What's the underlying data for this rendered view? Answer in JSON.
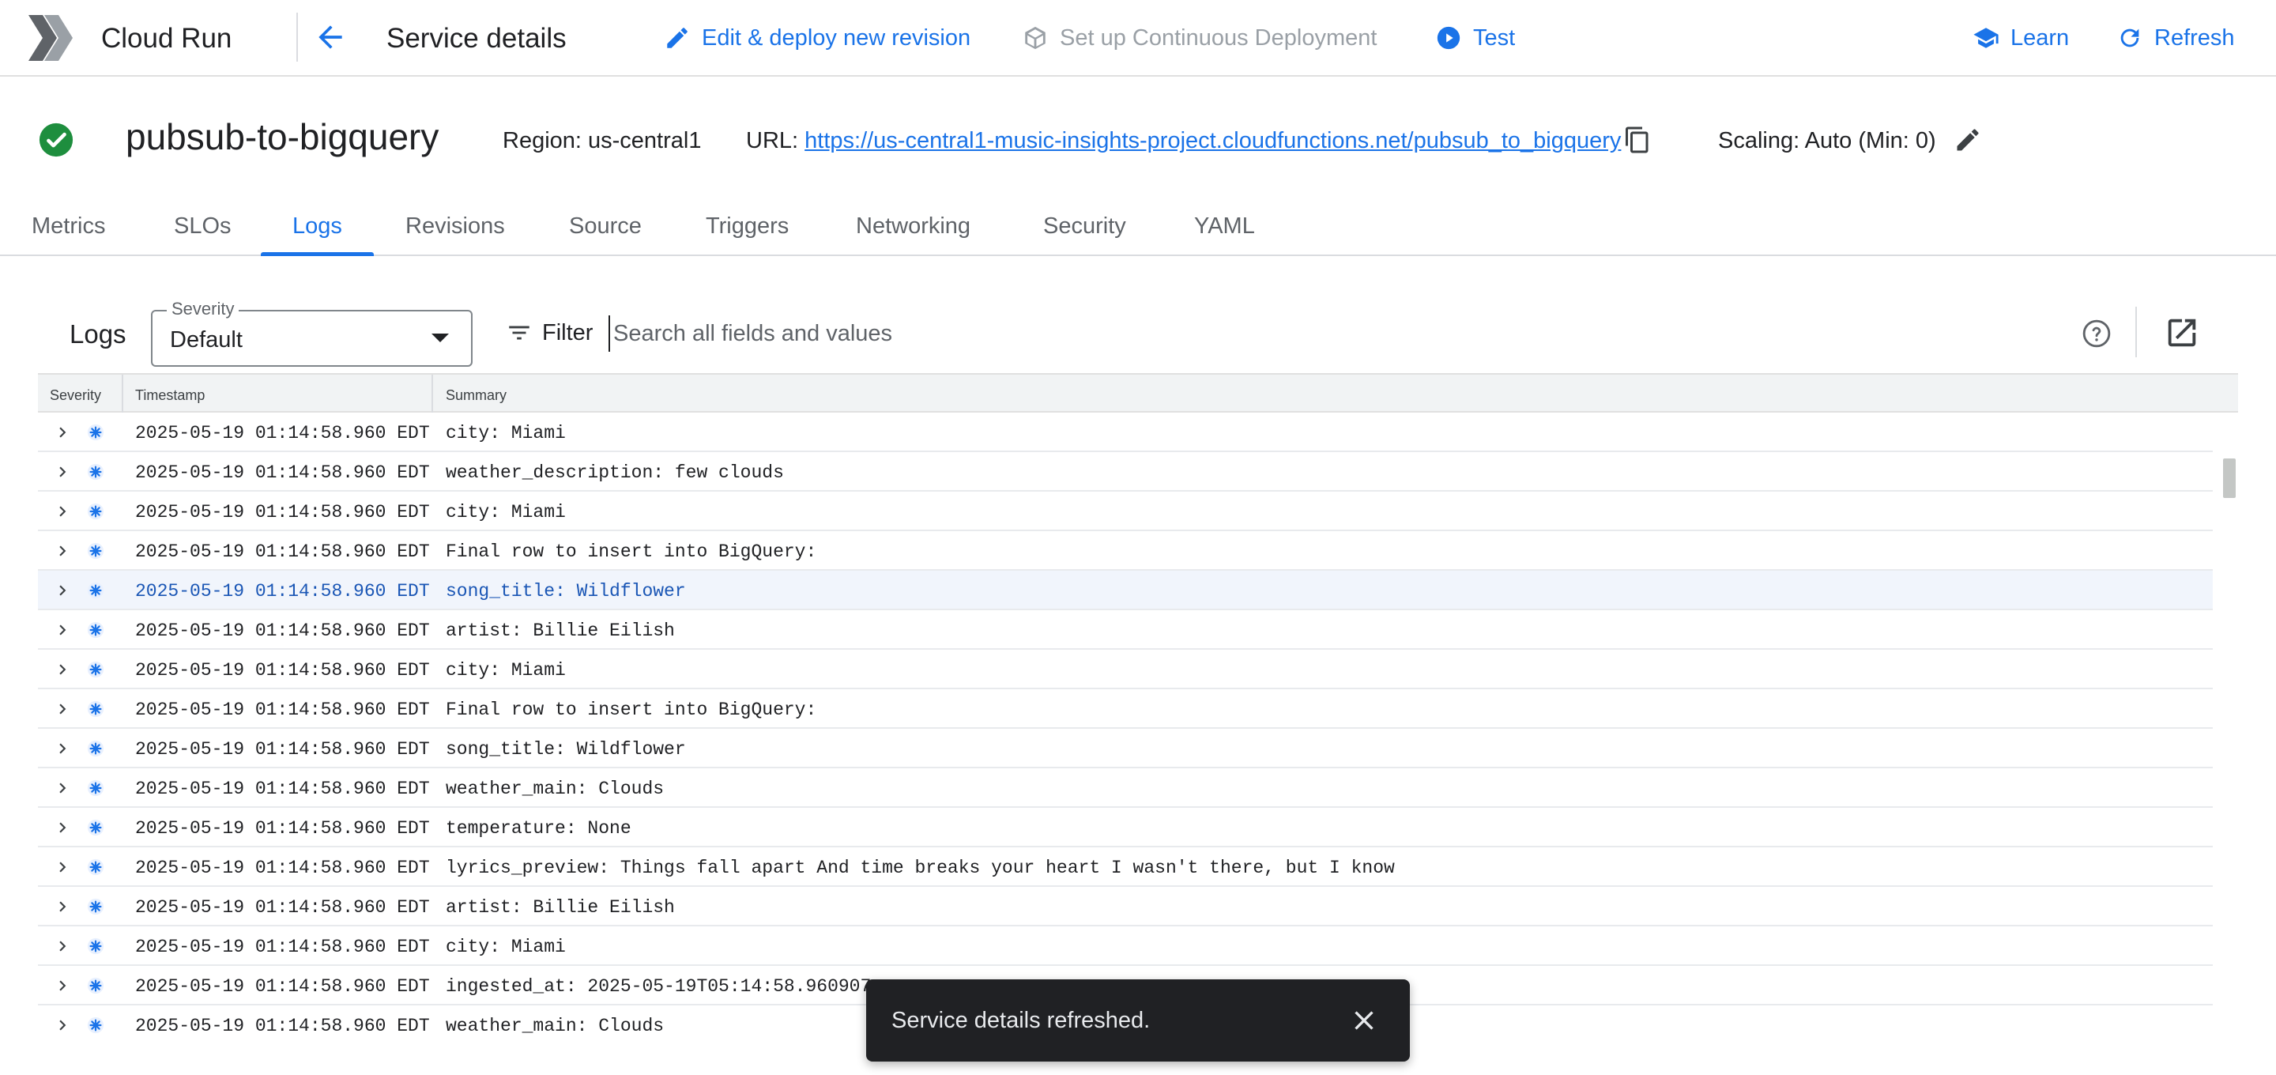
{
  "appbar": {
    "product": "Cloud Run",
    "page_title": "Service details",
    "actions": {
      "edit_deploy": "Edit & deploy new revision",
      "continuous_deployment": "Set up Continuous Deployment",
      "test": "Test",
      "learn": "Learn",
      "refresh": "Refresh"
    }
  },
  "service": {
    "name": "pubsub-to-bigquery",
    "region": "Region: us-central1",
    "url_label": "URL:",
    "url": "https://us-central1-music-insights-project.cloudfunctions.net/pubsub_to_bigquery",
    "scaling_label": "Scaling:",
    "scaling_value": "Auto",
    "scaling_min": "(Min: 0)"
  },
  "tabs": {
    "metrics": "Metrics",
    "slos": "SLOs",
    "logs": "Logs",
    "revisions": "Revisions",
    "source": "Source",
    "triggers": "Triggers",
    "networking": "Networking",
    "security": "Security",
    "yaml": "YAML"
  },
  "logs": {
    "title": "Logs",
    "severity_legend": "Severity",
    "severity_value": "Default",
    "filter_label": "Filter",
    "search_placeholder": "Search all fields and values",
    "columns": {
      "severity": "Severity",
      "timestamp": "Timestamp",
      "summary": "Summary"
    },
    "rows": [
      {
        "ts": "2025-05-19 01:14:58.960 EDT",
        "summary": "city: Miami"
      },
      {
        "ts": "2025-05-19 01:14:58.960 EDT",
        "summary": "weather_description: few clouds"
      },
      {
        "ts": "2025-05-19 01:14:58.960 EDT",
        "summary": "city: Miami"
      },
      {
        "ts": "2025-05-19 01:14:58.960 EDT",
        "summary": "Final row to insert into BigQuery:"
      },
      {
        "ts": "2025-05-19 01:14:58.960 EDT",
        "summary": "song_title: Wildflower"
      },
      {
        "ts": "2025-05-19 01:14:58.960 EDT",
        "summary": "artist: Billie Eilish"
      },
      {
        "ts": "2025-05-19 01:14:58.960 EDT",
        "summary": "city: Miami"
      },
      {
        "ts": "2025-05-19 01:14:58.960 EDT",
        "summary": "Final row to insert into BigQuery:"
      },
      {
        "ts": "2025-05-19 01:14:58.960 EDT",
        "summary": "song_title: Wildflower"
      },
      {
        "ts": "2025-05-19 01:14:58.960 EDT",
        "summary": "weather_main: Clouds"
      },
      {
        "ts": "2025-05-19 01:14:58.960 EDT",
        "summary": "temperature: None"
      },
      {
        "ts": "2025-05-19 01:14:58.960 EDT",
        "summary": "lyrics_preview: Things fall apart And time breaks your heart I wasn't there, but I know"
      },
      {
        "ts": "2025-05-19 01:14:58.960 EDT",
        "summary": "artist: Billie Eilish"
      },
      {
        "ts": "2025-05-19 01:14:58.960 EDT",
        "summary": "city: Miami"
      },
      {
        "ts": "2025-05-19 01:14:58.960 EDT",
        "summary": "ingested_at: 2025-05-19T05:14:58.960907"
      },
      {
        "ts": "2025-05-19 01:14:58.960 EDT",
        "summary": "weather_main: Clouds"
      }
    ]
  },
  "snackbar": {
    "message": "Service details refreshed."
  },
  "colors": {
    "accent": "#1a73e8",
    "success": "#1e8e3e",
    "severity_default": "#1a73e8",
    "snackbar_bg": "#202124"
  }
}
